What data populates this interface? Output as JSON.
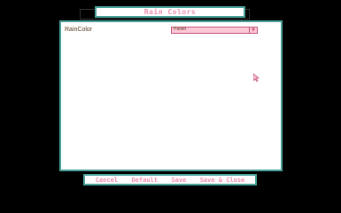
{
  "window": {
    "title": "Rain Colors"
  },
  "setting": {
    "label": "RainColor",
    "selected": "Pastel"
  },
  "buttons": {
    "cancel": "Cancel",
    "default": "Default",
    "save": "Save",
    "save_close": "Save & Close"
  }
}
